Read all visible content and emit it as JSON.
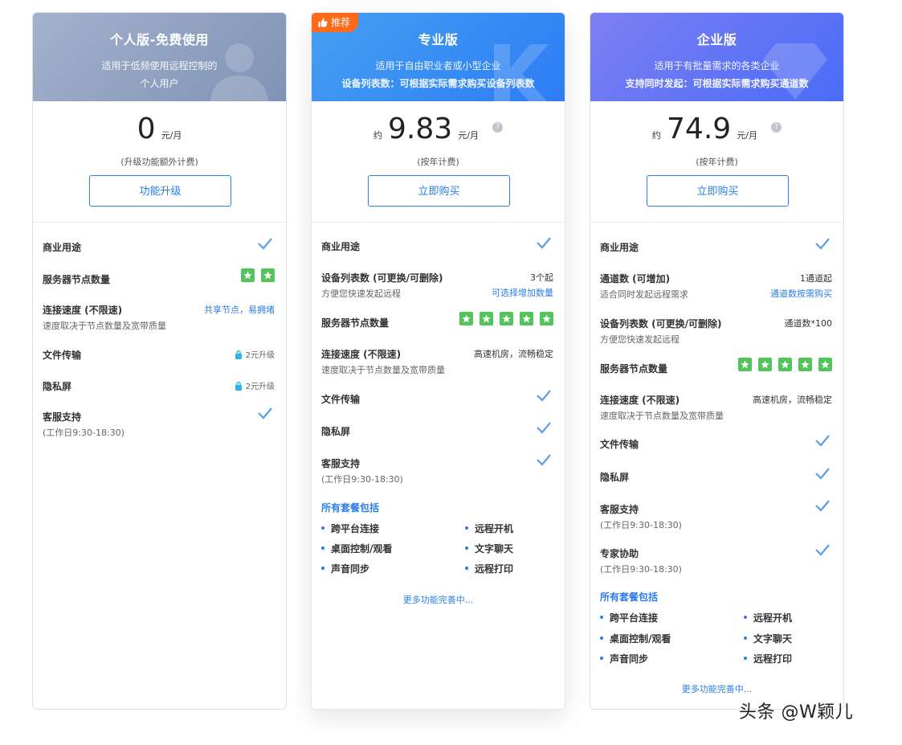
{
  "plans": {
    "personal": {
      "title": "个人版-免费使用",
      "subtitle_line1": "适用于低频使用远程控制的",
      "subtitle_line2": "个人用户",
      "price": "0",
      "unit": "元/月",
      "note": "(升级功能额外计费)",
      "button": "功能升级",
      "features": {
        "commercial": "商业用途",
        "nodes": "服务器节点数量",
        "nodes_stars": 2,
        "speed": "连接速度 (不限速)",
        "speed_sub": "速度取决于节点数量及宽带质量",
        "speed_value": "共享节点，易拥堵",
        "transfer": "文件传输",
        "transfer_value": "2元升级",
        "privacy": "隐私屏",
        "privacy_value": "2元升级",
        "support": "客服支持",
        "support_sub": "(工作日9:30-18:30)"
      }
    },
    "pro": {
      "badge": "推荐",
      "title": "专业版",
      "subtitle_line1": "适用于自由职业者或小型企业",
      "subtitle_line2": "设备列表数：可根据实际需求购买设备列表数",
      "approx": "约",
      "price": "9.83",
      "unit": "元/月",
      "note": "(按年计费)",
      "button": "立即购买",
      "features": {
        "commercial": "商业用途",
        "devices": "设备列表数 (可更换/可删除)",
        "devices_sub": "方便您快速发起远程",
        "devices_value": "3个起",
        "devices_link": "可选择增加数量",
        "nodes": "服务器节点数量",
        "nodes_stars": 5,
        "speed": "连接速度 (不限速)",
        "speed_sub": "速度取决于节点数量及宽带质量",
        "speed_value": "高速机房，流畅稳定",
        "transfer": "文件传输",
        "privacy": "隐私屏",
        "support": "客服支持",
        "support_sub": "(工作日9:30-18:30)"
      },
      "included_title": "所有套餐包括",
      "included": [
        "跨平台连接",
        "远程开机",
        "桌面控制/观看",
        "文字聊天",
        "声音同步",
        "远程打印"
      ],
      "more": "更多功能完善中..."
    },
    "enterprise": {
      "title": "企业版",
      "subtitle_line1": "适用于有批量需求的各类企业",
      "subtitle_line2": "支持同时发起：可根据实际需求购买通道数",
      "approx": "约",
      "price": "74.9",
      "unit": "元/月",
      "note": "(按年计费)",
      "button": "立即购买",
      "features": {
        "commercial": "商业用途",
        "channels": "通道数 (可增加)",
        "channels_sub": "适合同时发起远程需求",
        "channels_value": "1通道起",
        "channels_link": "通道数按需购买",
        "devices": "设备列表数 (可更换/可删除)",
        "devices_sub": "方便您快速发起远程",
        "devices_value": "通道数*100",
        "nodes": "服务器节点数量",
        "nodes_stars": 5,
        "speed": "连接速度 (不限速)",
        "speed_sub": "速度取决于节点数量及宽带质量",
        "speed_value": "高速机房，流畅稳定",
        "transfer": "文件传输",
        "privacy": "隐私屏",
        "support": "客服支持",
        "support_sub": "(工作日9:30-18:30)",
        "expert": "专家协助",
        "expert_sub": "(工作日9:30-18:30)"
      },
      "included_title": "所有套餐包括",
      "included": [
        "跨平台连接",
        "远程开机",
        "桌面控制/观看",
        "文字聊天",
        "声音同步",
        "远程打印"
      ],
      "more": "更多功能完善中..."
    }
  },
  "watermark": "头条 @W颖儿",
  "colors": {
    "accent": "#2b7de9",
    "star_green": "#52c45a",
    "badge_orange": "#ff6a1a",
    "check_blue": "#5b9cf0"
  }
}
